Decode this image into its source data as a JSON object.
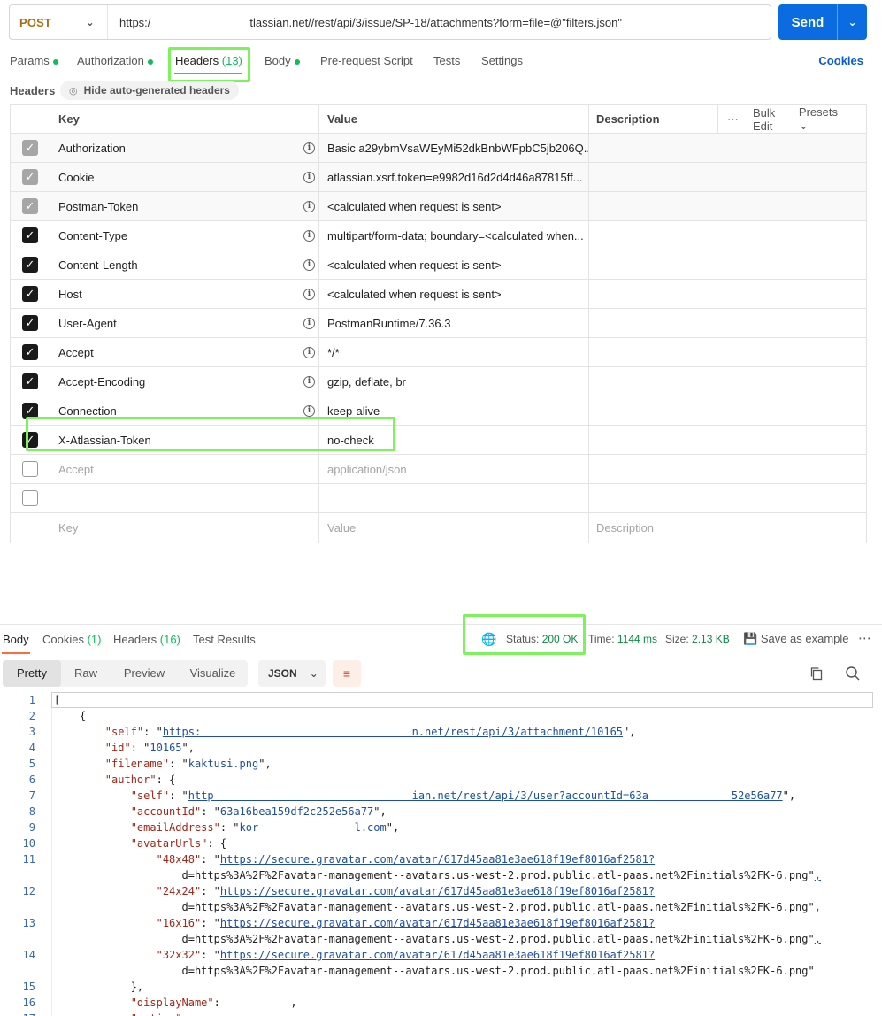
{
  "request": {
    "method": "POST",
    "url_prefix": "https:/",
    "url_suffix": "tlassian.net//rest/api/3/issue/SP-18/attachments?form=file=@\"filters.json\"",
    "send_label": "Send"
  },
  "tabs": {
    "params": "Params",
    "authorization": "Authorization",
    "headers": "Headers",
    "headers_count": "(13)",
    "body": "Body",
    "prerequest": "Pre-request Script",
    "tests": "Tests",
    "settings": "Settings",
    "cookies": "Cookies"
  },
  "headers_section": {
    "title": "Headers",
    "hide_auto": "Hide auto-generated headers",
    "col_key": "Key",
    "col_value": "Value",
    "col_description": "Description",
    "bulk_edit": "Bulk Edit",
    "presets": "Presets",
    "rows": [
      {
        "key": "Authorization",
        "value": "Basic a29ybmVsaWEyMi52dkBnbWFpbC5jb206Q...",
        "state": "grey",
        "info": true
      },
      {
        "key": "Cookie",
        "value": "atlassian.xsrf.token=e9982d16d2d4d46a87815ff...",
        "state": "grey",
        "info": true
      },
      {
        "key": "Postman-Token",
        "value": "<calculated when request is sent>",
        "state": "grey",
        "info": true
      },
      {
        "key": "Content-Type",
        "value": "multipart/form-data; boundary=<calculated when...",
        "state": "on",
        "info": true
      },
      {
        "key": "Content-Length",
        "value": "<calculated when request is sent>",
        "state": "on",
        "info": true
      },
      {
        "key": "Host",
        "value": "<calculated when request is sent>",
        "state": "on",
        "info": true
      },
      {
        "key": "User-Agent",
        "value": "PostmanRuntime/7.36.3",
        "state": "on",
        "info": true
      },
      {
        "key": "Accept",
        "value": "*/*",
        "state": "on",
        "info": true
      },
      {
        "key": "Accept-Encoding",
        "value": "gzip, deflate, br",
        "state": "on",
        "info": true
      },
      {
        "key": "Connection",
        "value": "keep-alive",
        "state": "on",
        "info": true
      },
      {
        "key": "X-Atlassian-Token",
        "value": "no-check",
        "state": "on",
        "info": false
      },
      {
        "key": "Accept",
        "value": "application/json",
        "state": "off",
        "info": false,
        "placeholder": true
      },
      {
        "key": "",
        "value": "",
        "state": "off",
        "info": false
      },
      {
        "key": "Key",
        "value": "Value",
        "desc": "Description",
        "state": "none",
        "info": false,
        "placeholder": true
      }
    ]
  },
  "response": {
    "tabs": {
      "body": "Body",
      "cookies": "Cookies",
      "cookies_count": "(1)",
      "headers": "Headers",
      "headers_count": "(16)",
      "test_results": "Test Results"
    },
    "status_label": "Status:",
    "status_value": "200 OK",
    "time_label": "Time:",
    "time_value": "1144 ms",
    "size_label": "Size:",
    "size_value": "2.13 KB",
    "save_example": "Save as example",
    "views": [
      "Pretty",
      "Raw",
      "Preview",
      "Visualize"
    ],
    "format": "JSON"
  },
  "code_lines": [
    {
      "n": "1",
      "t": "["
    },
    {
      "n": "2",
      "t": "    {"
    },
    {
      "n": "3",
      "t": "        \"self\": \"https:                                 n.net/rest/api/3/attachment/10165\","
    },
    {
      "n": "4",
      "t": "        \"id\": \"10165\","
    },
    {
      "n": "5",
      "t": "        \"filename\": \"kaktusi.png\","
    },
    {
      "n": "6",
      "t": "        \"author\": {"
    },
    {
      "n": "7",
      "t": "            \"self\": \"http                               ian.net/rest/api/3/user?accountId=63a             52e56a77\","
    },
    {
      "n": "8",
      "t": "            \"accountId\": \"63a16bea159df2c252e56a77\","
    },
    {
      "n": "9",
      "t": "            \"emailAddress\": \"kor               l.com\","
    },
    {
      "n": "10",
      "t": "            \"avatarUrls\": {"
    },
    {
      "n": "11",
      "t": "                \"48x48\": \"https://secure.gravatar.com/avatar/617d45aa81e3ae618f19ef8016af2581?"
    },
    {
      "n": "",
      "t": "                    d=https%3A%2F%2Favatar-management--avatars.us-west-2.prod.public.atl-paas.net%2Finitials%2FK-6.png\","
    },
    {
      "n": "12",
      "t": "                \"24x24\": \"https://secure.gravatar.com/avatar/617d45aa81e3ae618f19ef8016af2581?"
    },
    {
      "n": "",
      "t": "                    d=https%3A%2F%2Favatar-management--avatars.us-west-2.prod.public.atl-paas.net%2Finitials%2FK-6.png\","
    },
    {
      "n": "13",
      "t": "                \"16x16\": \"https://secure.gravatar.com/avatar/617d45aa81e3ae618f19ef8016af2581?"
    },
    {
      "n": "",
      "t": "                    d=https%3A%2F%2Favatar-management--avatars.us-west-2.prod.public.atl-paas.net%2Finitials%2FK-6.png\","
    },
    {
      "n": "14",
      "t": "                \"32x32\": \"https://secure.gravatar.com/avatar/617d45aa81e3ae618f19ef8016af2581?"
    },
    {
      "n": "",
      "t": "                    d=https%3A%2F%2Favatar-management--avatars.us-west-2.prod.public.atl-paas.net%2Finitials%2FK-6.png\""
    },
    {
      "n": "15",
      "t": "            },"
    },
    {
      "n": "16",
      "t": "            \"displayName\":           ,"
    },
    {
      "n": "17",
      "t": "            \"active\": "
    }
  ],
  "colors": {
    "accent": "#0a6ce0",
    "method": "#a86e11",
    "tab_active": "#ff6c37",
    "success": "#0ebd5a",
    "highlight": "#7cf35c"
  }
}
